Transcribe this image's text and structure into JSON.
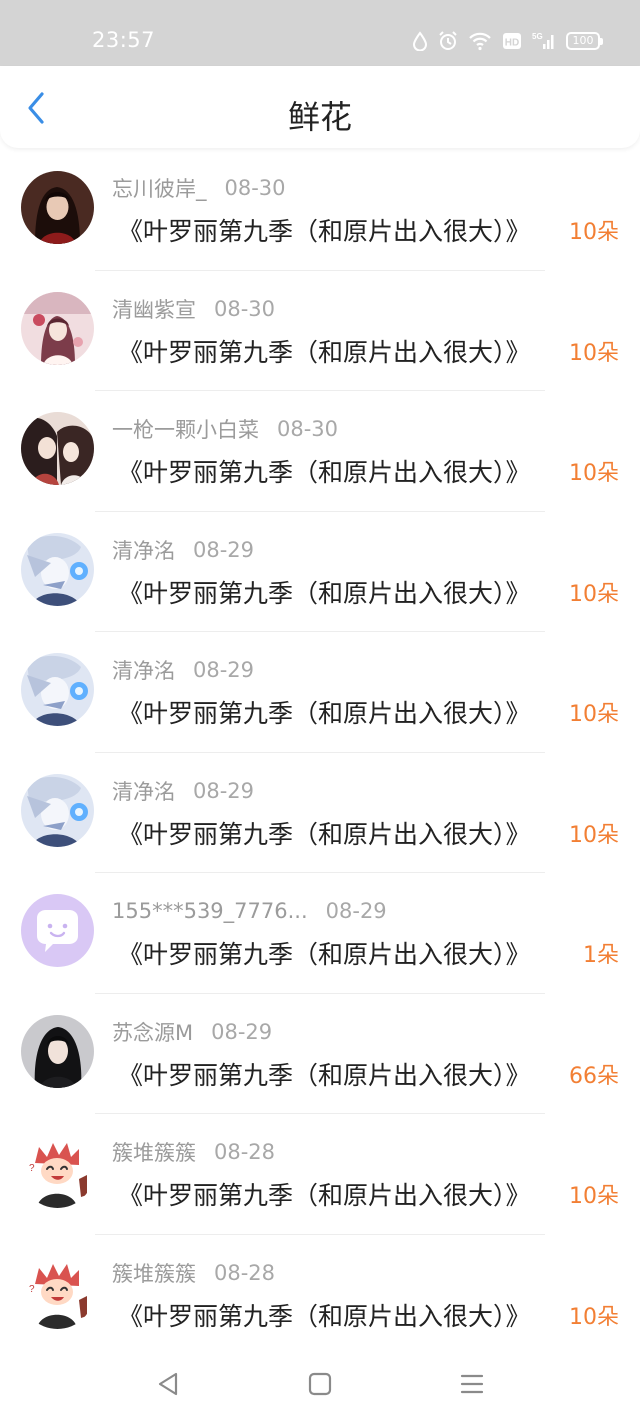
{
  "status_bar": {
    "time": "23:57",
    "battery": "100",
    "network": "5G",
    "hd": "HD",
    "icons": [
      "water-drop-icon",
      "alarm-icon",
      "wifi-icon",
      "hd-icon",
      "signal-5g-icon",
      "battery-icon"
    ]
  },
  "header": {
    "title": "鲜花",
    "back_icon": "chevron-left-icon",
    "accent_color": "#3a8ee6"
  },
  "colors": {
    "flower_count": "#f27f34",
    "username": "#9b9b9b",
    "title_text": "#222222"
  },
  "items": [
    {
      "user": "忘川彼岸_",
      "date": "08-30",
      "title": "《叶罗丽第九季（和原片出入很大）》",
      "flowers": "10朵",
      "avatar": "dark-haired-girl-avatar"
    },
    {
      "user": "清幽紫宣",
      "date": "08-30",
      "title": "《叶罗丽第九季（和原片出入很大）》",
      "flowers": "10朵",
      "avatar": "pink-anime-girl-avatar"
    },
    {
      "user": "一枪一颗小白菜",
      "date": "08-30",
      "title": "《叶罗丽第九季（和原片出入很大）》",
      "flowers": "10朵",
      "avatar": "ancient-style-couple-avatar"
    },
    {
      "user": "清净洺",
      "date": "08-29",
      "title": "《叶罗丽第九季（和原片出入很大）》",
      "flowers": "10朵",
      "avatar": "white-haired-anime-avatar"
    },
    {
      "user": "清净洺",
      "date": "08-29",
      "title": "《叶罗丽第九季（和原片出入很大）》",
      "flowers": "10朵",
      "avatar": "white-haired-anime-avatar"
    },
    {
      "user": "清净洺",
      "date": "08-29",
      "title": "《叶罗丽第九季（和原片出入很大）》",
      "flowers": "10朵",
      "avatar": "white-haired-anime-avatar"
    },
    {
      "user": "155***539_7776...",
      "date": "08-29",
      "title": "《叶罗丽第九季（和原片出入很大）》",
      "flowers": "1朵",
      "avatar": "default-chat-bubble-avatar"
    },
    {
      "user": "苏念源M",
      "date": "08-29",
      "title": "《叶罗丽第九季（和原片出入很大）》",
      "flowers": "66朵",
      "avatar": "dark-haired-woman-avatar"
    },
    {
      "user": "簇堆簇簇",
      "date": "08-28",
      "title": "《叶罗丽第九季（和原片出入很大）》",
      "flowers": "10朵",
      "avatar": "red-haired-chibi-avatar"
    },
    {
      "user": "簇堆簇簇",
      "date": "08-28",
      "title": "《叶罗丽第九季（和原片出入很大）》",
      "flowers": "10朵",
      "avatar": "red-haired-chibi-avatar"
    }
  ],
  "system_nav": [
    "back-triangle-icon",
    "home-square-icon",
    "menu-lines-icon"
  ]
}
